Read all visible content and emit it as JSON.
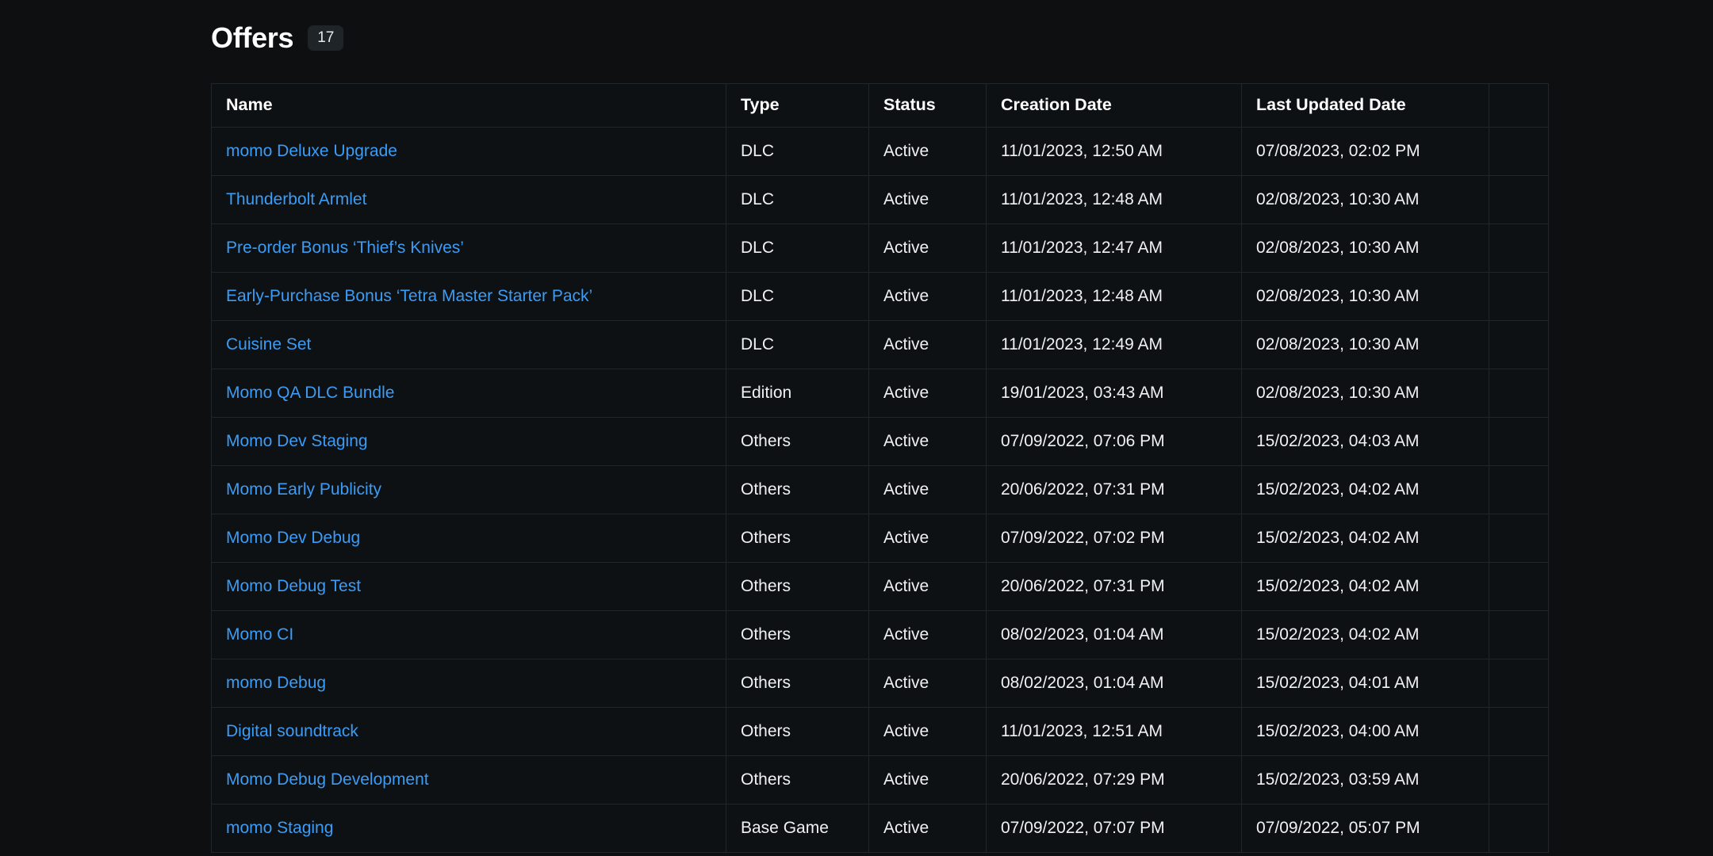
{
  "header": {
    "title": "Offers",
    "count": "17"
  },
  "table": {
    "columns": [
      {
        "key": "name",
        "label": "Name"
      },
      {
        "key": "type",
        "label": "Type"
      },
      {
        "key": "status",
        "label": "Status"
      },
      {
        "key": "created",
        "label": "Creation Date"
      },
      {
        "key": "updated",
        "label": "Last Updated Date"
      },
      {
        "key": "actions",
        "label": ""
      }
    ],
    "rows": [
      {
        "name": "momo Deluxe Upgrade",
        "type": "DLC",
        "status": "Active",
        "created": "11/01/2023, 12:50 AM",
        "updated": "07/08/2023, 02:02 PM"
      },
      {
        "name": "Thunderbolt Armlet",
        "type": "DLC",
        "status": "Active",
        "created": "11/01/2023, 12:48 AM",
        "updated": "02/08/2023, 10:30 AM"
      },
      {
        "name": "Pre-order Bonus ‘Thief’s Knives’",
        "type": "DLC",
        "status": "Active",
        "created": "11/01/2023, 12:47 AM",
        "updated": "02/08/2023, 10:30 AM"
      },
      {
        "name": "Early-Purchase Bonus ‘Tetra Master Starter Pack’",
        "type": "DLC",
        "status": "Active",
        "created": "11/01/2023, 12:48 AM",
        "updated": "02/08/2023, 10:30 AM"
      },
      {
        "name": "Cuisine Set",
        "type": "DLC",
        "status": "Active",
        "created": "11/01/2023, 12:49 AM",
        "updated": "02/08/2023, 10:30 AM"
      },
      {
        "name": "Momo QA DLC Bundle",
        "type": "Edition",
        "status": "Active",
        "created": "19/01/2023, 03:43 AM",
        "updated": "02/08/2023, 10:30 AM"
      },
      {
        "name": "Momo Dev Staging",
        "type": "Others",
        "status": "Active",
        "created": "07/09/2022, 07:06 PM",
        "updated": "15/02/2023, 04:03 AM"
      },
      {
        "name": "Momo Early Publicity",
        "type": "Others",
        "status": "Active",
        "created": "20/06/2022, 07:31 PM",
        "updated": "15/02/2023, 04:02 AM"
      },
      {
        "name": "Momo Dev Debug",
        "type": "Others",
        "status": "Active",
        "created": "07/09/2022, 07:02 PM",
        "updated": "15/02/2023, 04:02 AM"
      },
      {
        "name": "Momo Debug Test",
        "type": "Others",
        "status": "Active",
        "created": "20/06/2022, 07:31 PM",
        "updated": "15/02/2023, 04:02 AM"
      },
      {
        "name": "Momo CI",
        "type": "Others",
        "status": "Active",
        "created": "08/02/2023, 01:04 AM",
        "updated": "15/02/2023, 04:02 AM"
      },
      {
        "name": "momo Debug",
        "type": "Others",
        "status": "Active",
        "created": "08/02/2023, 01:04 AM",
        "updated": "15/02/2023, 04:01 AM"
      },
      {
        "name": "Digital soundtrack",
        "type": "Others",
        "status": "Active",
        "created": "11/01/2023, 12:51 AM",
        "updated": "15/02/2023, 04:00 AM"
      },
      {
        "name": "Momo Debug Development",
        "type": "Others",
        "status": "Active",
        "created": "20/06/2022, 07:29 PM",
        "updated": "15/02/2023, 03:59 AM"
      },
      {
        "name": "momo Staging",
        "type": "Base Game",
        "status": "Active",
        "created": "07/09/2022, 07:07 PM",
        "updated": "07/09/2022, 05:07 PM"
      }
    ]
  },
  "colors": {
    "background": "#0d0f11",
    "link": "#3b9cf5",
    "border": "#22262b",
    "badge_bg": "#1f2428",
    "text": "#f0f1f2"
  }
}
